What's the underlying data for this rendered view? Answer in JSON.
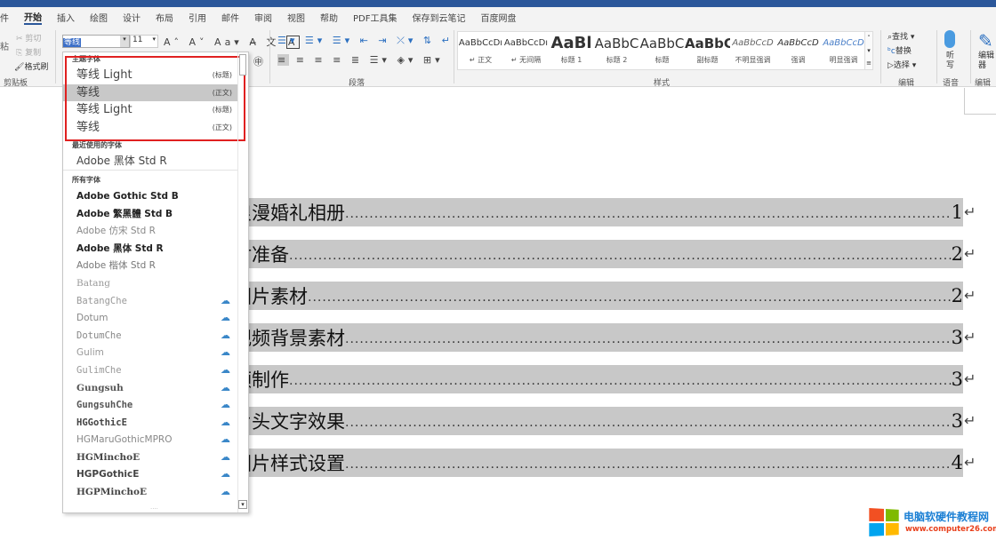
{
  "tabs": [
    "件",
    "开始",
    "插入",
    "绘图",
    "设计",
    "布局",
    "引用",
    "邮件",
    "审阅",
    "视图",
    "帮助",
    "PDF工具集",
    "保存到云笔记",
    "百度网盘"
  ],
  "clipboard": {
    "paste": "粘",
    "cut": "剪切",
    "copy": "复制",
    "format_painter": "格式刷",
    "label": "剪贴板"
  },
  "font": {
    "name": "等线",
    "size": "11"
  },
  "paragraph_label": "段落",
  "styles": {
    "items": [
      {
        "preview": "AaBbCcDı",
        "name": "↵ 正文"
      },
      {
        "preview": "AaBbCcDı",
        "name": "↵ 无间隔"
      },
      {
        "preview": "AaBl",
        "name": "标题 1"
      },
      {
        "preview": "AaBbC",
        "name": "标题 2"
      },
      {
        "preview": "AaBbC",
        "name": "标题"
      },
      {
        "preview": "AaBbC",
        "name": "副标题"
      },
      {
        "preview": "AaBbCcD",
        "name": "不明显强调"
      },
      {
        "preview": "AaBbCcD",
        "name": "强调"
      },
      {
        "preview": "AaBbCcD",
        "name": "明显强调"
      }
    ],
    "label": "样式"
  },
  "editing": {
    "find": "查找",
    "replace": "替换",
    "select": "选择",
    "label": "编辑"
  },
  "voice": {
    "dictate": "听写",
    "label": "语音"
  },
  "editor": {
    "button": "编辑器",
    "label": "编辑器"
  },
  "dropdown": {
    "theme_header": "主题字体",
    "theme_fonts": [
      {
        "name": "等线 Light",
        "tag": "(标题)"
      },
      {
        "name": "等线",
        "tag": "(正文)",
        "selected": true
      },
      {
        "name": "等线 Light",
        "tag": "(标题)"
      },
      {
        "name": "等线",
        "tag": "(正文)"
      }
    ],
    "recent_header": "最近使用的字体",
    "recent_fonts": [
      "Adobe 黑体 Std R"
    ],
    "all_header": "所有字体",
    "all_fonts": [
      {
        "name": "Adobe Gothic Std B"
      },
      {
        "name": "Adobe 繁黑體 Std B"
      },
      {
        "name": "Adobe 仿宋 Std R"
      },
      {
        "name": "Adobe 黑体 Std R"
      },
      {
        "name": "Adobe 楷体 Std R"
      },
      {
        "name": "Batang"
      },
      {
        "name": "BatangChe",
        "cloud": true
      },
      {
        "name": "Dotum",
        "cloud": true
      },
      {
        "name": "DotumChe",
        "cloud": true
      },
      {
        "name": "Gulim",
        "cloud": true
      },
      {
        "name": "GulimChe",
        "cloud": true
      },
      {
        "name": "Gungsuh",
        "cloud": true
      },
      {
        "name": "GungsuhChe",
        "cloud": true
      },
      {
        "name": "HGGothicE",
        "cloud": true
      },
      {
        "name": "HGMaruGothicMPRO",
        "cloud": true
      },
      {
        "name": "HGMinchoE",
        "cloud": true
      },
      {
        "name": "HGPGothicE",
        "cloud": true
      },
      {
        "name": "HGPMinchoE",
        "cloud": true
      }
    ]
  },
  "toc": [
    {
      "title": "浪漫婚礼相册",
      "page": "1"
    },
    {
      "title": "材准备",
      "page": "2"
    },
    {
      "title": "图片素材",
      "page": "2"
    },
    {
      "title": "视频背景素材",
      "page": "3"
    },
    {
      "title": "频制作",
      "page": "3"
    },
    {
      "title": "片头文字效果",
      "page": "3"
    },
    {
      "title": "图片样式设置",
      "page": "4"
    }
  ],
  "watermark": {
    "name": "电脑软硬件教程网",
    "url": "www.computer26.com"
  },
  "colors": {
    "accent": "#2b579a",
    "highlight_red": "#e02020",
    "toc_bg": "#c8c8c8"
  }
}
